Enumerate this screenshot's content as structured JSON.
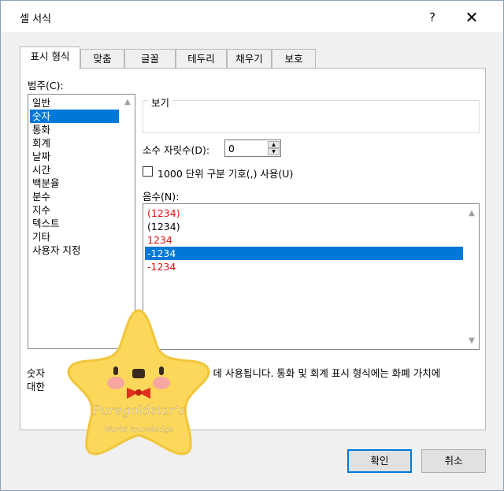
{
  "window": {
    "title": "셀 서식",
    "help": "?",
    "close": "✕"
  },
  "tabs": [
    "표시 형식",
    "맞춤",
    "글꼴",
    "테두리",
    "채우기",
    "보호"
  ],
  "category": {
    "label": "범주(C):",
    "items": [
      "일반",
      "숫자",
      "통화",
      "회계",
      "날짜",
      "시간",
      "백분율",
      "분수",
      "지수",
      "텍스트",
      "기타",
      "사용자 지정"
    ],
    "selected_index": 1
  },
  "sample": {
    "label": "보기",
    "value": ""
  },
  "decimal_places": {
    "label": "소수 자릿수(D):",
    "value": "0"
  },
  "thousands_separator": {
    "label": "1000 단위 구분 기호(,) 사용(U)",
    "checked": false
  },
  "negative_numbers": {
    "label": "음수(N):",
    "items": [
      {
        "text": "(1234)",
        "color": "#e01010"
      },
      {
        "text": "(1234)",
        "color": "#000000"
      },
      {
        "text": "1234",
        "color": "#e01010"
      },
      {
        "text": "-1234",
        "color": "#000000"
      },
      {
        "text": "-1234",
        "color": "#e01010"
      }
    ],
    "selected_index": 3
  },
  "description": {
    "line1_start": "숫자",
    "line1_end": "는 데 사용됩니다. 통화 및 회계 표시 형식에는 화폐 가치에",
    "line2_start": "대한 "
  },
  "watermark": {
    "line1": "Puregoldstar's",
    "line2": "World knowledge"
  },
  "buttons": {
    "ok": "확인",
    "cancel": "취소"
  },
  "colors": {
    "selection": "#0078d7",
    "negative_red": "#e01010",
    "sticker_yellow": "#fbd85a"
  }
}
